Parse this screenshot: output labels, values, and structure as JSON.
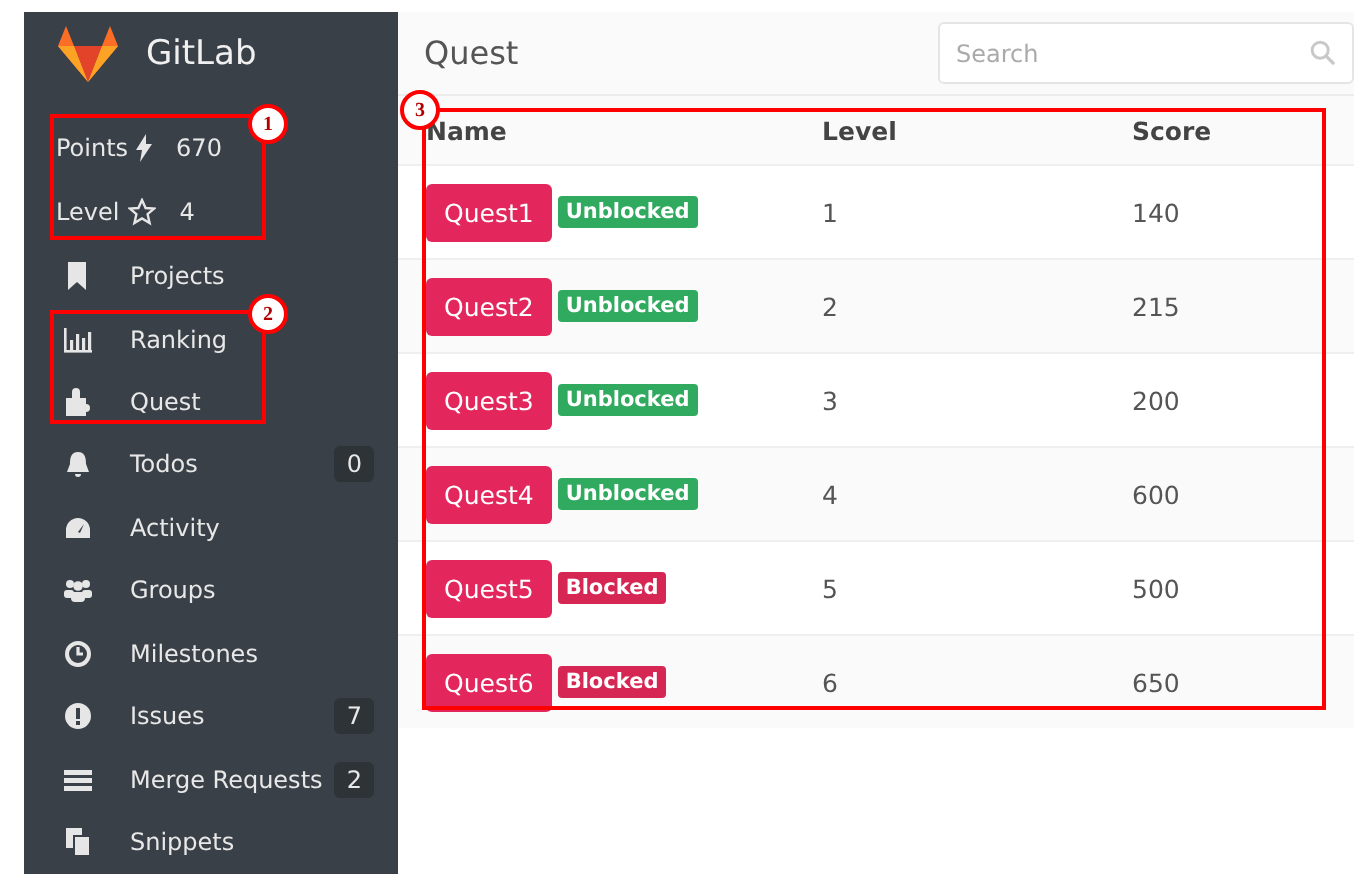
{
  "brand": {
    "name": "GitLab"
  },
  "stats": [
    {
      "kind": "points",
      "label": "Points",
      "value": "670"
    },
    {
      "kind": "level",
      "label": "Level",
      "value": "4"
    }
  ],
  "sidebar": {
    "items": [
      {
        "label": "Projects"
      },
      {
        "label": "Ranking"
      },
      {
        "label": "Quest"
      },
      {
        "label": "Todos",
        "count": "0"
      },
      {
        "label": "Activity"
      },
      {
        "label": "Groups"
      },
      {
        "label": "Milestones"
      },
      {
        "label": "Issues",
        "count": "7"
      },
      {
        "label": "Merge Requests",
        "count": "2"
      },
      {
        "label": "Snippets"
      }
    ]
  },
  "page": {
    "title": "Quest",
    "search": {
      "placeholder": "Search"
    }
  },
  "table": {
    "columns": [
      "Name",
      "Level",
      "Score"
    ],
    "rows": [
      {
        "name": "Quest1",
        "status": "Unblocked",
        "blocked": false,
        "level": "1",
        "score": "140"
      },
      {
        "name": "Quest2",
        "status": "Unblocked",
        "blocked": false,
        "level": "2",
        "score": "215"
      },
      {
        "name": "Quest3",
        "status": "Unblocked",
        "blocked": false,
        "level": "3",
        "score": "200"
      },
      {
        "name": "Quest4",
        "status": "Unblocked",
        "blocked": false,
        "level": "4",
        "score": "600"
      },
      {
        "name": "Quest5",
        "status": "Blocked",
        "blocked": true,
        "level": "5",
        "score": "500"
      },
      {
        "name": "Quest6",
        "status": "Blocked",
        "blocked": true,
        "level": "6",
        "score": "650"
      }
    ]
  },
  "annotations": [
    {
      "number": "1"
    },
    {
      "number": "2"
    },
    {
      "number": "3"
    }
  ]
}
